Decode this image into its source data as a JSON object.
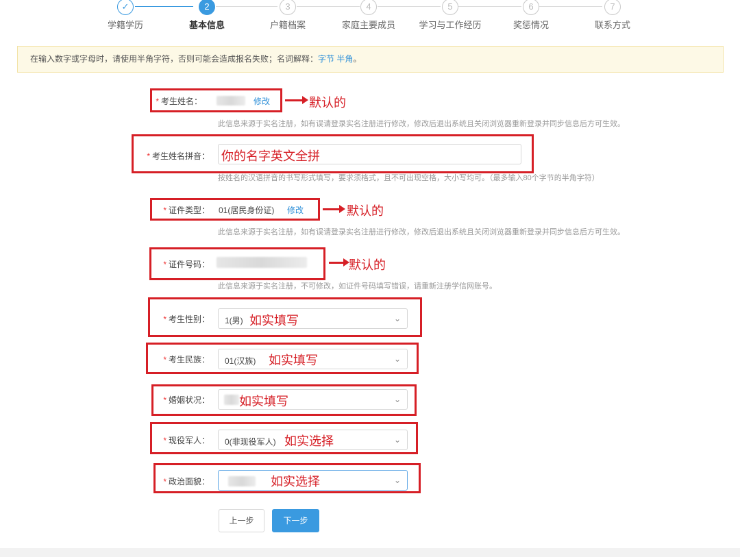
{
  "stepper": {
    "steps": [
      {
        "num": "✓",
        "label": "学籍学历",
        "state": "done"
      },
      {
        "num": "2",
        "label": "基本信息",
        "state": "active"
      },
      {
        "num": "3",
        "label": "户籍档案",
        "state": "todo"
      },
      {
        "num": "4",
        "label": "家庭主要成员",
        "state": "todo"
      },
      {
        "num": "5",
        "label": "学习与工作经历",
        "state": "todo"
      },
      {
        "num": "6",
        "label": "奖惩情况",
        "state": "todo"
      },
      {
        "num": "7",
        "label": "联系方式",
        "state": "todo"
      }
    ]
  },
  "notice": {
    "text": "在输入数字或字母时，请使用半角字符，否则可能会造成报名失败；名词解释：",
    "link1": "字节",
    "link2": "半角",
    "end": "。"
  },
  "form": {
    "required_mark": "*",
    "name": {
      "label": "考生姓名：",
      "edit": "修改",
      "help": "此信息来源于实名注册，如有误请登录实名注册进行修改，修改后退出系统且关闭浏览器重新登录并同步信息后方可生效。"
    },
    "pinyin": {
      "label": "考生姓名拼音：",
      "help": "按姓名的汉语拼音的书写形式填写，要求须格式，且不可出现空格，大小写均可。（最多输入80个字节的半角字符）"
    },
    "id_type": {
      "label": "证件类型：",
      "value": "01(居民身份证)",
      "edit": "修改",
      "help": "此信息来源于实名注册，如有误请登录实名注册进行修改，修改后退出系统且关闭浏览器重新登录并同步信息后方可生效。"
    },
    "id_number": {
      "label": "证件号码：",
      "help": "此信息来源于实名注册，不可修改，如证件号码填写错误，请重新注册学信网账号。"
    },
    "gender": {
      "label": "考生性别：",
      "value": "1(男)"
    },
    "ethnicity": {
      "label": "考生民族：",
      "value": "01(汉族)"
    },
    "marital": {
      "label": "婚姻状况：",
      "value": ""
    },
    "military": {
      "label": "现役军人：",
      "value": "0(非现役军人)"
    },
    "political": {
      "label": "政治面貌：",
      "value": ""
    }
  },
  "annotations": {
    "default": "默认的",
    "pinyin_hint": "你的名字英文全拼",
    "fill_truthfully": "如实填写",
    "choose_truthfully": "如实选择",
    "color": "#d61f26"
  },
  "buttons": {
    "prev": "上一步",
    "next": "下一步"
  },
  "colors": {
    "accent": "#3a9ae0",
    "link": "#2d8fd8",
    "required": "#e33"
  },
  "icons": {
    "chevron": "chevron-down-icon",
    "check": "check-icon"
  }
}
